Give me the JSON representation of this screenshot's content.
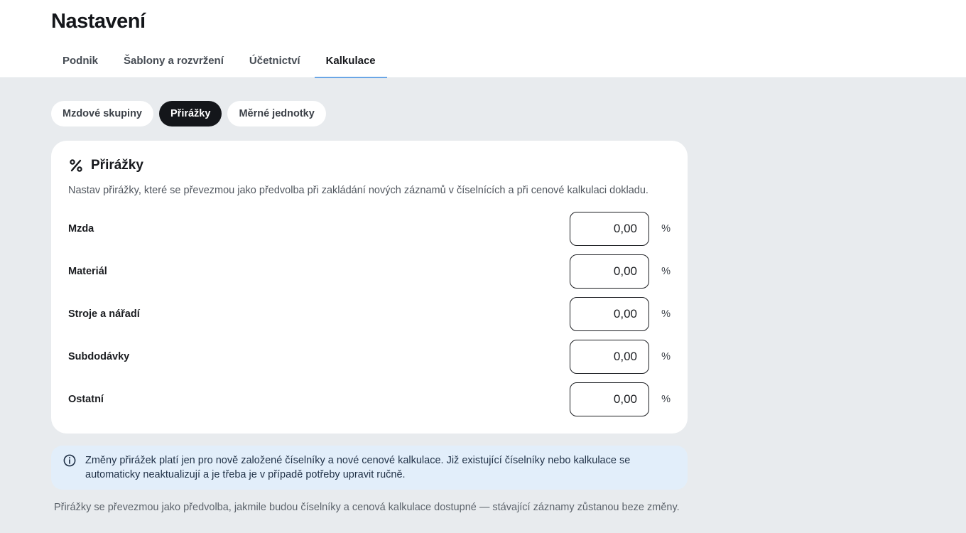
{
  "page": {
    "title": "Nastavení"
  },
  "tabs": [
    {
      "label": "Podnik",
      "active": false
    },
    {
      "label": "Šablony a rozvržení",
      "active": false
    },
    {
      "label": "Účetnictví",
      "active": false
    },
    {
      "label": "Kalkulace",
      "active": true
    }
  ],
  "subtabs": [
    {
      "label": "Mzdové skupiny",
      "active": false
    },
    {
      "label": "Přirážky",
      "active": true
    },
    {
      "label": "Měrné jednotky",
      "active": false
    }
  ],
  "card": {
    "icon": "percent-icon",
    "title": "Přirážky",
    "description": "Nastav přirážky, které se převezmou jako předvolba při zakládání nových záznamů v číselnících a při cenové kalkulaci dokladu.",
    "rows": [
      {
        "label": "Mzda",
        "value": "0,00",
        "unit": "%"
      },
      {
        "label": "Materiál",
        "value": "0,00",
        "unit": "%"
      },
      {
        "label": "Stroje a nářadí",
        "value": "0,00",
        "unit": "%"
      },
      {
        "label": "Subdodávky",
        "value": "0,00",
        "unit": "%"
      },
      {
        "label": "Ostatní",
        "value": "0,00",
        "unit": "%"
      }
    ]
  },
  "info": {
    "icon": "info-icon",
    "text": "Změny přirážek platí jen pro nově založené číselníky a nové cenové kalkulace. Již existující číselníky nebo kalkulace se automaticky neaktualizují a je třeba je v případě potřeby upravit ručně."
  },
  "footnote": "Přirážky se převezmou jako předvolba, jakmile budou číselníky a cenová kalkulace dostupné — stávající záznamy zůstanou beze změny.",
  "colors": {
    "page_background": "#e8ebee",
    "active_pill": "#14161a",
    "active_tab_underline": "#6aa6e6",
    "info_background": "#e2eefa"
  }
}
